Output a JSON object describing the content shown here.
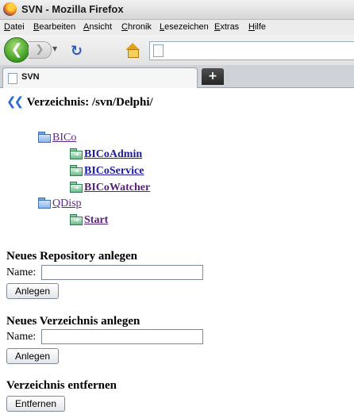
{
  "window": {
    "title": "SVN - Mozilla Firefox"
  },
  "menu": [
    "Datei",
    "Bearbeiten",
    "Ansicht",
    "Chronik",
    "Lesezeichen",
    "Extras",
    "Hilfe"
  ],
  "tab": {
    "label": "SVN",
    "new_tab": "+"
  },
  "page": {
    "heading": "Verzeichnis: /svn/Delphi/",
    "tree": [
      {
        "label": "BICo",
        "type": "folder",
        "children": [
          {
            "label": "BICoAdmin",
            "type": "repo"
          },
          {
            "label": "BICoService",
            "type": "repo"
          },
          {
            "label": "BICoWatcher",
            "type": "repo"
          }
        ]
      },
      {
        "label": "QDisp",
        "type": "folder",
        "children": [
          {
            "label": "Start",
            "type": "repo"
          }
        ]
      }
    ],
    "new_repo": {
      "title": "Neues Repository anlegen",
      "name_label": "Name:",
      "name_value": "",
      "button": "Anlegen"
    },
    "new_dir": {
      "title": "Neues Verzeichnis anlegen",
      "name_label": "Name:",
      "name_value": "",
      "button": "Anlegen"
    },
    "remove_dir": {
      "title": "Verzeichnis entfernen",
      "button": "Entfernen"
    }
  }
}
